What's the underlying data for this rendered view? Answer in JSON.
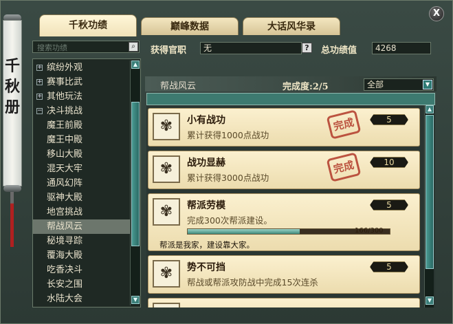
{
  "banner": {
    "title": "千秋册"
  },
  "close_label": "X",
  "tabs": [
    {
      "label": "千秋功绩",
      "active": true
    },
    {
      "label": "巅峰数据",
      "active": false
    },
    {
      "label": "大话风华录",
      "active": false
    }
  ],
  "search": {
    "placeholder": "搜索功绩",
    "icon": "search-icon"
  },
  "sidebar": {
    "items": [
      {
        "label": "缤纷外观",
        "type": "category",
        "expanded": false
      },
      {
        "label": "赛事比武",
        "type": "category",
        "expanded": false
      },
      {
        "label": "其他玩法",
        "type": "category",
        "expanded": false
      },
      {
        "label": "决斗挑战",
        "type": "category",
        "expanded": true
      },
      {
        "label": "魔王前殿",
        "type": "item"
      },
      {
        "label": "魔王中殿",
        "type": "item"
      },
      {
        "label": "移山大殿",
        "type": "item"
      },
      {
        "label": "混天大牢",
        "type": "item"
      },
      {
        "label": "通风幻阵",
        "type": "item"
      },
      {
        "label": "驱神大殿",
        "type": "item"
      },
      {
        "label": "地宫挑战",
        "type": "item"
      },
      {
        "label": "帮战风云",
        "type": "item",
        "selected": true
      },
      {
        "label": "秘境寻踪",
        "type": "item"
      },
      {
        "label": "覆海大殿",
        "type": "item"
      },
      {
        "label": "吃香决斗",
        "type": "item"
      },
      {
        "label": "长安之围",
        "type": "item"
      },
      {
        "label": "水陆大会",
        "type": "item"
      }
    ]
  },
  "header": {
    "title_label": "获得官职",
    "title_value": "无",
    "help": "?",
    "score_label": "总功绩值",
    "score_value": "4268"
  },
  "category": {
    "name": "帮战风云",
    "progress_label": "完成度:",
    "progress": "2/5",
    "filter": "全部"
  },
  "achievements": [
    {
      "name": "小有战功",
      "desc": "累计获得1000点战功",
      "points": "5",
      "completed": true,
      "stamp": "完成"
    },
    {
      "name": "战功显赫",
      "desc": "累计获得3000点战功",
      "points": "10",
      "completed": true,
      "stamp": "完成"
    },
    {
      "name": "帮派劳模",
      "desc": "完成300次帮派建设。",
      "points": "5",
      "completed": false,
      "progress_text": "166/300",
      "progress_fraction": 0.553,
      "slogan": "帮派是我家，建设靠大家。"
    },
    {
      "name": "势不可挡",
      "desc": "帮战或帮派攻防战中完成15次连杀",
      "points": "5",
      "completed": false
    }
  ]
}
